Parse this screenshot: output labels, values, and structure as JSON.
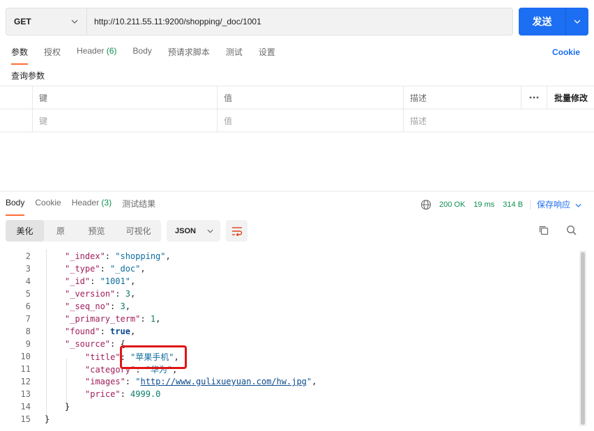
{
  "request": {
    "method": "GET",
    "url": "http://10.211.55.11:9200/shopping/_doc/1001",
    "send_label": "发送"
  },
  "request_tabs": [
    {
      "label": "参数",
      "active": true
    },
    {
      "label": "授权"
    },
    {
      "label": "Header",
      "count": "(6)"
    },
    {
      "label": "Body"
    },
    {
      "label": "预请求脚本"
    },
    {
      "label": "测试"
    },
    {
      "label": "设置"
    }
  ],
  "cookie_link": "Cookie",
  "query_params": {
    "title": "查询参数",
    "headers": {
      "key": "键",
      "value": "值",
      "desc": "描述",
      "bulk_edit": "批量修改"
    },
    "placeholders": {
      "key": "键",
      "value": "值",
      "desc": "描述"
    }
  },
  "response_tabs": [
    {
      "label": "Body",
      "active": true
    },
    {
      "label": "Cookie"
    },
    {
      "label": "Header",
      "count": "(3)"
    },
    {
      "label": "测试结果"
    }
  ],
  "response_status": {
    "status": "200 OK",
    "time": "19 ms",
    "size": "314 B",
    "save_label": "保存响应"
  },
  "view_modes": [
    {
      "label": "美化",
      "active": true
    },
    {
      "label": "原"
    },
    {
      "label": "预览"
    },
    {
      "label": "可视化"
    }
  ],
  "format_select": "JSON",
  "code_lines": [
    {
      "n": "2",
      "indent": 1,
      "parts": [
        [
          "k",
          "\"_index\""
        ],
        [
          "p",
          ": "
        ],
        [
          "s",
          "\"shopping\""
        ],
        [
          "p",
          ","
        ]
      ]
    },
    {
      "n": "3",
      "indent": 1,
      "parts": [
        [
          "k",
          "\"_type\""
        ],
        [
          "p",
          ": "
        ],
        [
          "s",
          "\"_doc\""
        ],
        [
          "p",
          ","
        ]
      ]
    },
    {
      "n": "4",
      "indent": 1,
      "parts": [
        [
          "k",
          "\"_id\""
        ],
        [
          "p",
          ": "
        ],
        [
          "s",
          "\"1001\""
        ],
        [
          "p",
          ","
        ]
      ]
    },
    {
      "n": "5",
      "indent": 1,
      "parts": [
        [
          "k",
          "\"_version\""
        ],
        [
          "p",
          ": "
        ],
        [
          "n",
          "3"
        ],
        [
          "p",
          ","
        ]
      ]
    },
    {
      "n": "6",
      "indent": 1,
      "parts": [
        [
          "k",
          "\"_seq_no\""
        ],
        [
          "p",
          ": "
        ],
        [
          "n",
          "3"
        ],
        [
          "p",
          ","
        ]
      ]
    },
    {
      "n": "7",
      "indent": 1,
      "parts": [
        [
          "k",
          "\"_primary_term\""
        ],
        [
          "p",
          ": "
        ],
        [
          "n",
          "1"
        ],
        [
          "p",
          ","
        ]
      ]
    },
    {
      "n": "8",
      "indent": 1,
      "parts": [
        [
          "k",
          "\"found\""
        ],
        [
          "p",
          ": "
        ],
        [
          "b",
          "true"
        ],
        [
          "p",
          ","
        ]
      ]
    },
    {
      "n": "9",
      "indent": 1,
      "parts": [
        [
          "k",
          "\"_source\""
        ],
        [
          "p",
          ": {"
        ]
      ]
    },
    {
      "n": "10",
      "indent": 2,
      "parts": [
        [
          "k",
          "\"title\""
        ],
        [
          "p",
          ": "
        ],
        [
          "s",
          "\"苹果手机\""
        ],
        [
          "p",
          ","
        ]
      ]
    },
    {
      "n": "11",
      "indent": 2,
      "parts": [
        [
          "k",
          "\"category\""
        ],
        [
          "p",
          ": "
        ],
        [
          "s",
          "\"华为\""
        ],
        [
          "p",
          ","
        ]
      ]
    },
    {
      "n": "12",
      "indent": 2,
      "parts": [
        [
          "k",
          "\"images\""
        ],
        [
          "p",
          ": "
        ],
        [
          "s",
          "\""
        ],
        [
          "lnk",
          "http://www.gulixueyuan.com/hw.jpg"
        ],
        [
          "s",
          "\""
        ],
        [
          "p",
          ","
        ]
      ]
    },
    {
      "n": "13",
      "indent": 2,
      "parts": [
        [
          "k",
          "\"price\""
        ],
        [
          "p",
          ": "
        ],
        [
          "n",
          "4999.0"
        ]
      ]
    },
    {
      "n": "14",
      "indent": 1,
      "parts": [
        [
          "p",
          "}"
        ]
      ]
    },
    {
      "n": "15",
      "indent": 0,
      "parts": [
        [
          "p",
          "}"
        ]
      ]
    }
  ]
}
